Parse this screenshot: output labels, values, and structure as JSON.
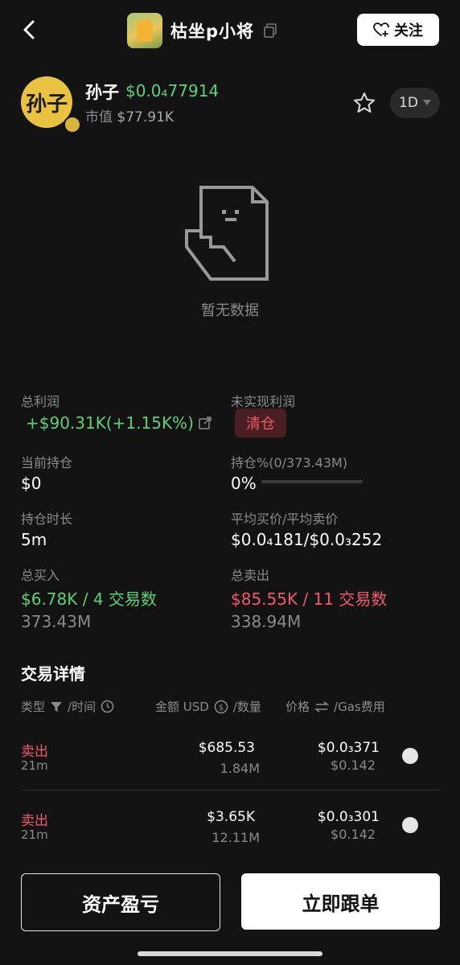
{
  "header": {
    "user_name": "枯坐p小将",
    "follow_label": "关注"
  },
  "token": {
    "avatar_text": "孙子",
    "name": "孙子",
    "price": "$0.0₄77914",
    "mcap_label": "市值",
    "mcap_value": "$77.91K",
    "period": "1D"
  },
  "empty": {
    "text": "暂无数据"
  },
  "stats": {
    "total_profit_label": "总利润",
    "total_profit_value": "+$90.31K(+1.15K%)",
    "unrealized_label": "未实现利润",
    "unrealized_badge": "清仓",
    "position_label": "当前持仓",
    "position_value": "$0",
    "position_pct_label": "持仓%(0/373.43M)",
    "position_pct_value": "0%",
    "position_pct_fill": 0,
    "hold_time_label": "持仓时长",
    "hold_time_value": "5m",
    "avg_price_label": "平均买价/平均卖价",
    "avg_price_value": "$0.0₄181/$0.0₃252",
    "total_buy_label": "总买入",
    "total_buy_value": "$6.78K / 4 交易数",
    "total_buy_amount": "373.43M",
    "total_sell_label": "总卖出",
    "total_sell_value": "$85.55K / 11 交易数",
    "total_sell_amount": "338.94M"
  },
  "trades": {
    "title": "交易详情",
    "col_type": "类型",
    "col_time": "/时间",
    "col_amount": "金额 USD",
    "col_qty": "/数量",
    "col_price": "价格",
    "col_gas": "/Gas费用",
    "rows": [
      {
        "type": "卖出",
        "time": "21m",
        "amount": "$685.53",
        "qty": "1.84M",
        "price": "$0.0₃371",
        "gas": "$0.142"
      },
      {
        "type": "卖出",
        "time": "21m",
        "amount": "$3.65K",
        "qty": "12.11M",
        "price": "$0.0₃301",
        "gas": "$0.142"
      }
    ]
  },
  "footer": {
    "pnl_button": "资产盈亏",
    "copy_button": "立即跟单"
  },
  "colors": {
    "green": "#5fcf7a",
    "red": "#f0596b",
    "bg": "#131313"
  }
}
